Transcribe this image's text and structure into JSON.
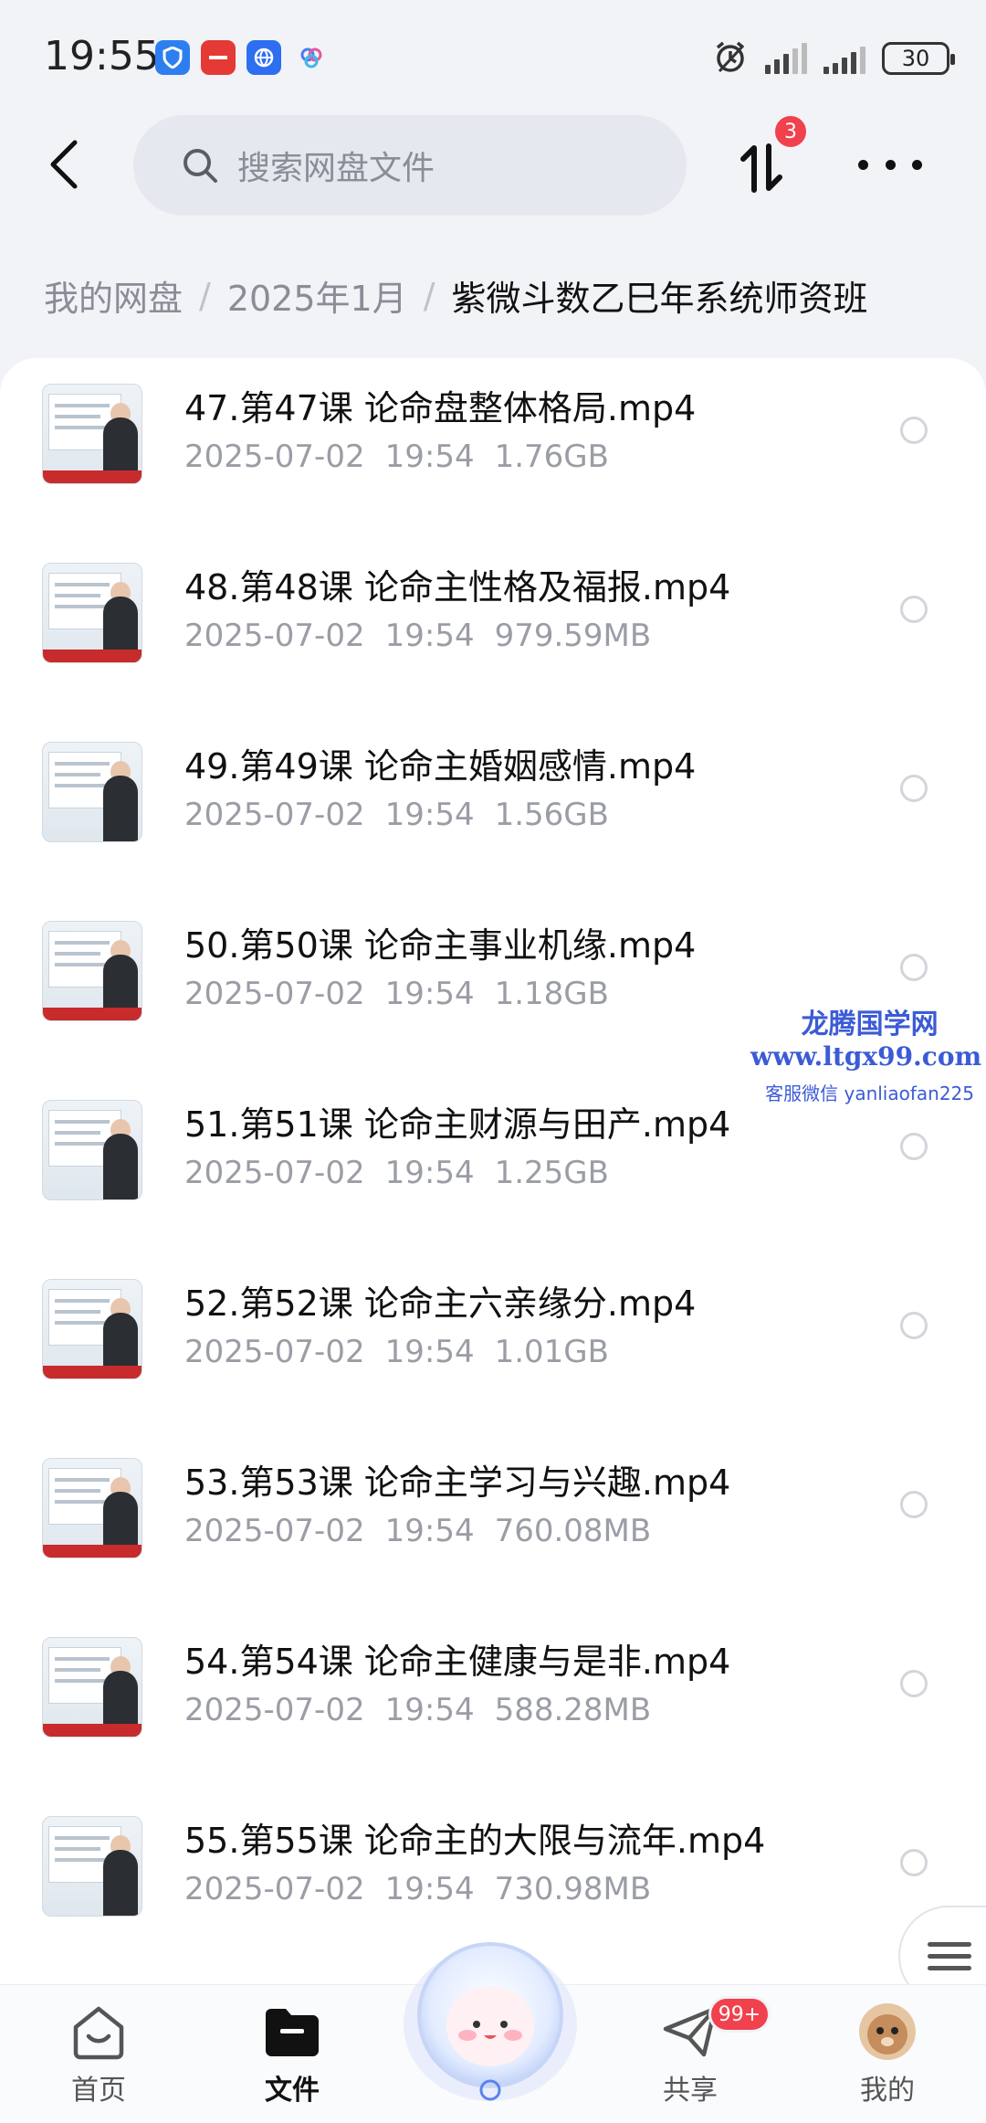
{
  "status_bar": {
    "time": "19:55",
    "battery": "30",
    "app_icons": [
      "shield-app-icon",
      "huawei-app-icon",
      "browser-app-icon",
      "cloud-app-icon"
    ]
  },
  "header": {
    "search_placeholder": "搜索网盘文件",
    "transfer_badge": "3"
  },
  "breadcrumb": {
    "items": [
      "我的网盘",
      "2025年1月"
    ],
    "current": "紫微斗数乙巳年系统师资班"
  },
  "files": [
    {
      "name": "47.第47课 论命盘整体格局.mp4",
      "date": "2025-07-02",
      "time": "19:54",
      "size": "1.76GB"
    },
    {
      "name": "48.第48课 论命主性格及福报.mp4",
      "date": "2025-07-02",
      "time": "19:54",
      "size": "979.59MB"
    },
    {
      "name": "49.第49课 论命主婚姻感情.mp4",
      "date": "2025-07-02",
      "time": "19:54",
      "size": "1.56GB"
    },
    {
      "name": "50.第50课 论命主事业机缘.mp4",
      "date": "2025-07-02",
      "time": "19:54",
      "size": "1.18GB"
    },
    {
      "name": "51.第51课 论命主财源与田产.mp4",
      "date": "2025-07-02",
      "time": "19:54",
      "size": "1.25GB"
    },
    {
      "name": "52.第52课 论命主六亲缘分.mp4",
      "date": "2025-07-02",
      "time": "19:54",
      "size": "1.01GB"
    },
    {
      "name": "53.第53课 论命主学习与兴趣.mp4",
      "date": "2025-07-02",
      "time": "19:54",
      "size": "760.08MB"
    },
    {
      "name": "54.第54课 论命主健康与是非.mp4",
      "date": "2025-07-02",
      "time": "19:54",
      "size": "588.28MB"
    },
    {
      "name": "55.第55课 论命主的大限与流年.mp4",
      "date": "2025-07-02",
      "time": "19:54",
      "size": "730.98MB"
    }
  ],
  "watermark": {
    "line1": "龙腾国学网",
    "line2": "www.ltgx99.com",
    "line3": "客服微信 yanliaofan225"
  },
  "bottom_nav": {
    "home": "首页",
    "files": "文件",
    "share": "共享",
    "share_badge": "99+",
    "mine": "我的"
  },
  "colors": {
    "accent_badge": "#f0414d",
    "watermark": "#3c5bd6"
  }
}
